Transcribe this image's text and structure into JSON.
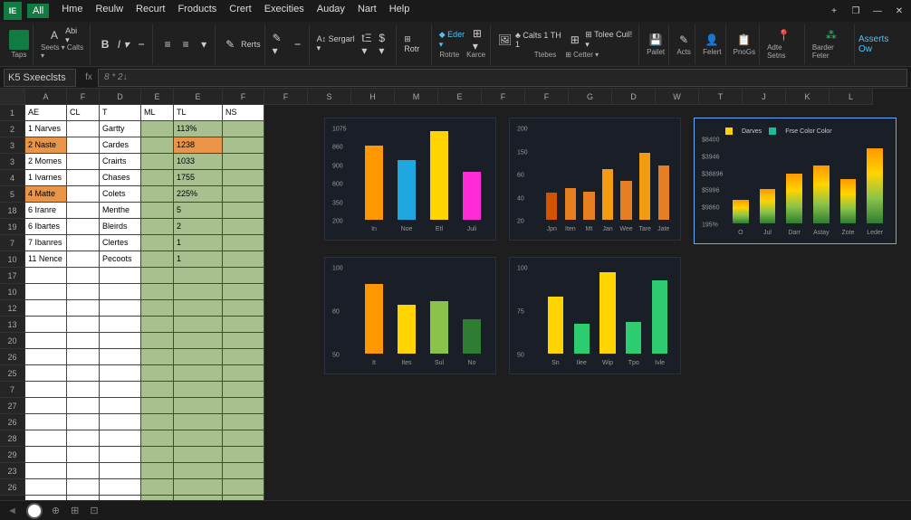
{
  "app": {
    "icon_text": "IE",
    "menus": [
      "All",
      "Hme",
      "Reulw",
      "Recurt",
      "Froducts",
      "Crert",
      "Execities",
      "Auday",
      "Nart",
      "Help"
    ],
    "win_plus": "+",
    "win_rest": "❐",
    "win_min": "—",
    "win_close": "✕",
    "assists": "Asserts  Ow"
  },
  "ribbon": {
    "groups": [
      {
        "icon": "paste",
        "label": "Taps"
      },
      {
        "row": [
          {
            "t": "A",
            "sup": "↕"
          },
          {
            "t": "Abi ▾"
          }
        ],
        "label": "Seets ▾ Calts ▾"
      },
      {
        "row": [
          {
            "t": "B"
          },
          {
            "t": "I ▾"
          },
          {
            "t": "⎯"
          }
        ],
        "label": ""
      },
      {
        "row": [
          {
            "t": "≡"
          },
          {
            "t": "≡"
          },
          {
            "t": "▾"
          }
        ],
        "label": ""
      },
      {
        "row": [
          {
            "t": "✎"
          },
          {
            "t": "Rerts"
          }
        ],
        "label": ""
      },
      {
        "row": [
          {
            "t": "✎ ▾"
          },
          {
            "t": "⎯"
          }
        ],
        "label": ""
      },
      {
        "row": [
          {
            "t": "A↕ Sergarl ▾"
          },
          {
            "t": "tΞ ▾"
          },
          {
            "t": "$ ▾"
          }
        ],
        "label": ""
      },
      {
        "row": [
          {
            "t": "⊞ Rotr"
          }
        ],
        "label": ""
      },
      {
        "row": [
          {
            "t": "◆ Eder ▾"
          },
          {
            "t": "⊞ ▾"
          }
        ],
        "row2": [
          {
            "t": "Rotrte"
          },
          {
            "t": "Karce"
          }
        ],
        "label": ""
      },
      {
        "row": [
          {
            "t": "🖼"
          },
          {
            "t": "♣ Calts 1 TH 1"
          },
          {
            "t": "⊞"
          },
          {
            "t": "⊞ Tolee Cuil! ▾"
          }
        ],
        "row2": [
          {
            "t": "Ttebes"
          },
          {
            "t": "⊞ Cetter ▾"
          }
        ],
        "label": ""
      },
      {
        "row": [
          {
            "t": "💾"
          }
        ],
        "label": "Pailet"
      },
      {
        "row": [
          {
            "t": "✎"
          }
        ],
        "label": "Acts"
      },
      {
        "row": [
          {
            "t": "👤"
          }
        ],
        "label": "Felert"
      },
      {
        "row": [
          {
            "t": "📋"
          }
        ],
        "label": "PnoGs"
      },
      {
        "row": [
          {
            "t": "📍",
            "c": "#e74c3c"
          }
        ],
        "label": "Adte Setns"
      },
      {
        "row": [
          {
            "t": "⁂",
            "c": "#2ecc71"
          }
        ],
        "label": "Barder Feter"
      }
    ]
  },
  "formula_bar": {
    "name": "K5 Sxeeclsts",
    "fx": "fx",
    "content": "8 *    2↓"
  },
  "columns": {
    "main_widths": [
      46,
      36,
      46,
      36,
      54,
      46
    ],
    "main_labels": [
      "A",
      "F",
      "D",
      "E",
      "E",
      "F"
    ],
    "sub_labels": [
      "AE",
      "CL",
      "T",
      "ML",
      "TL",
      "NS"
    ],
    "dark_labels": [
      "F",
      "S",
      "H",
      "M",
      "E",
      "F",
      "F",
      "G",
      "D",
      "W",
      "T",
      "J",
      "K",
      "L"
    ],
    "dark_width": 48
  },
  "row_numbers": [
    1,
    2,
    3,
    3,
    4,
    5,
    18,
    19,
    7,
    10,
    17,
    10,
    12,
    13,
    20,
    26,
    25,
    7,
    27,
    26,
    28,
    29,
    23,
    26
  ],
  "table": {
    "rows": [
      {
        "a": "1 Narves",
        "d": "Gartty",
        "e": "113%",
        "hl_a": false,
        "hl_e": false
      },
      {
        "a": "2 Naste",
        "d": "Cardes",
        "e": "1238",
        "hl_a": true,
        "hl_e": true
      },
      {
        "a": "2 Momes",
        "d": "Crairts",
        "e": "1033",
        "hl_a": false,
        "hl_e": false
      },
      {
        "a": "1 Ivarnes",
        "d": "Chases",
        "e": "1755",
        "hl_a": false,
        "hl_e": false
      },
      {
        "a": "4 Matte",
        "d": "Colets",
        "e": "225%",
        "hl_a": true,
        "hl_e": false
      },
      {
        "a": "6 Iranre",
        "d": "Menthe",
        "e": "5",
        "hl_a": false,
        "hl_e": false
      },
      {
        "a": "6 Ibartes",
        "d": "Bleirds",
        "e": "2",
        "hl_a": false,
        "hl_e": false
      },
      {
        "a": "7 Ibanres",
        "d": "Clertes",
        "e": "1",
        "hl_a": false,
        "hl_e": false
      },
      {
        "a": "11 Nence",
        "d": "Pecoots",
        "e": "1",
        "hl_a": false,
        "hl_e": false
      }
    ],
    "empty_rows": 15
  },
  "chart_data": [
    {
      "id": "c1",
      "type": "bar",
      "pos": [
        20,
        14,
        190,
        136
      ],
      "yticks": [
        "1075",
        "860",
        "900",
        "800",
        "350",
        "200"
      ],
      "categories": [
        "In",
        "Noe",
        "Etl",
        "Juli"
      ],
      "values": [
        860,
        700,
        1030,
        560
      ],
      "colors": [
        "#ff9800",
        "#1fa8e0",
        "#ffd400",
        "#ff2bd6"
      ],
      "ylim": [
        0,
        1075
      ]
    },
    {
      "id": "c2",
      "type": "bar",
      "pos": [
        224,
        14,
        190,
        136
      ],
      "yticks": [
        "200",
        "150",
        "60",
        "40",
        "20"
      ],
      "categories": [
        "Jpn",
        "Iten",
        "Mt",
        "Jan",
        "Wee",
        "Tare",
        "Jate"
      ],
      "values": [
        58,
        68,
        60,
        110,
        85,
        145,
        118
      ],
      "colors": [
        "#d35400",
        "#e67e22",
        "#e67e22",
        "#f39c12",
        "#e67e22",
        "#f39c12",
        "#e67e22"
      ],
      "ylim": [
        0,
        200
      ]
    },
    {
      "id": "c3",
      "type": "bar",
      "pos": [
        428,
        14,
        224,
        140
      ],
      "border": "#6af",
      "legend": [
        {
          "c": "#ffd400",
          "t": "Darves"
        },
        {
          "c": "#1abc9c",
          "t": "Frse Color Color"
        }
      ],
      "yticks": [
        "$8400",
        "$3946",
        "$38896",
        "$5996",
        "$9860",
        "195%"
      ],
      "categories": [
        "O",
        "Jul",
        "Darr",
        "Astay",
        "Zote",
        "Leder"
      ],
      "values": [
        28,
        40,
        58,
        68,
        52,
        88
      ],
      "gradient": true,
      "ylim": [
        0,
        100
      ]
    },
    {
      "id": "c4",
      "type": "bar",
      "pos": [
        20,
        168,
        190,
        130
      ],
      "yticks": [
        "100",
        "80",
        "50"
      ],
      "categories": [
        "It",
        "Ites",
        "Sul",
        "No"
      ],
      "values": [
        80,
        56,
        60,
        40
      ],
      "colors": [
        "#ff9800",
        "#ffd400",
        "#8bc34a",
        "#2e7d32"
      ],
      "ylim": [
        0,
        100
      ]
    },
    {
      "id": "c5",
      "type": "bar",
      "pos": [
        224,
        168,
        190,
        130
      ],
      "yticks": [
        "100",
        "75",
        "50"
      ],
      "categories": [
        "Sn",
        "Ilee",
        "Wip",
        "Tpo",
        "Ivle"
      ],
      "values": [
        66,
        34,
        94,
        36,
        84
      ],
      "colors": [
        "#ffd400",
        "#2ecc71",
        "#ffd400",
        "#2ecc71",
        "#2ecc71"
      ],
      "ylim": [
        0,
        100
      ]
    }
  ],
  "statusbar": {
    "tabs": 3,
    "active": 0,
    "icons": [
      "⊕",
      "⊞",
      "⊡"
    ]
  }
}
